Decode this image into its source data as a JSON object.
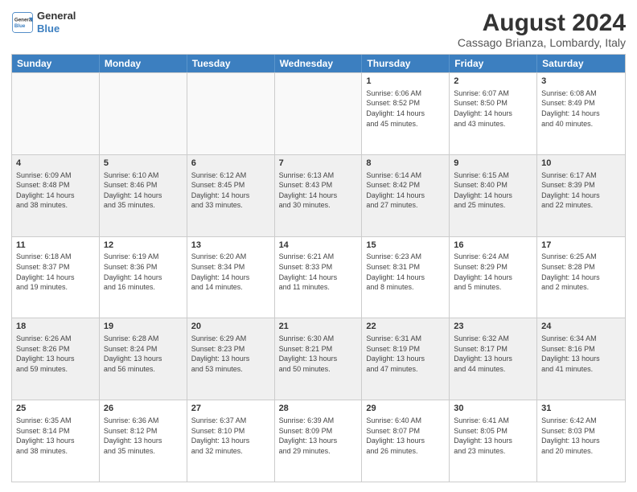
{
  "header": {
    "logo_line1": "General",
    "logo_line2": "Blue",
    "main_title": "August 2024",
    "subtitle": "Cassago Brianza, Lombardy, Italy"
  },
  "weekdays": [
    "Sunday",
    "Monday",
    "Tuesday",
    "Wednesday",
    "Thursday",
    "Friday",
    "Saturday"
  ],
  "rows": [
    [
      {
        "day": "",
        "info": "",
        "empty": true
      },
      {
        "day": "",
        "info": "",
        "empty": true
      },
      {
        "day": "",
        "info": "",
        "empty": true
      },
      {
        "day": "",
        "info": "",
        "empty": true
      },
      {
        "day": "1",
        "info": "Sunrise: 6:06 AM\nSunset: 8:52 PM\nDaylight: 14 hours\nand 45 minutes.",
        "empty": false
      },
      {
        "day": "2",
        "info": "Sunrise: 6:07 AM\nSunset: 8:50 PM\nDaylight: 14 hours\nand 43 minutes.",
        "empty": false
      },
      {
        "day": "3",
        "info": "Sunrise: 6:08 AM\nSunset: 8:49 PM\nDaylight: 14 hours\nand 40 minutes.",
        "empty": false
      }
    ],
    [
      {
        "day": "4",
        "info": "Sunrise: 6:09 AM\nSunset: 8:48 PM\nDaylight: 14 hours\nand 38 minutes.",
        "empty": false
      },
      {
        "day": "5",
        "info": "Sunrise: 6:10 AM\nSunset: 8:46 PM\nDaylight: 14 hours\nand 35 minutes.",
        "empty": false
      },
      {
        "day": "6",
        "info": "Sunrise: 6:12 AM\nSunset: 8:45 PM\nDaylight: 14 hours\nand 33 minutes.",
        "empty": false
      },
      {
        "day": "7",
        "info": "Sunrise: 6:13 AM\nSunset: 8:43 PM\nDaylight: 14 hours\nand 30 minutes.",
        "empty": false
      },
      {
        "day": "8",
        "info": "Sunrise: 6:14 AM\nSunset: 8:42 PM\nDaylight: 14 hours\nand 27 minutes.",
        "empty": false
      },
      {
        "day": "9",
        "info": "Sunrise: 6:15 AM\nSunset: 8:40 PM\nDaylight: 14 hours\nand 25 minutes.",
        "empty": false
      },
      {
        "day": "10",
        "info": "Sunrise: 6:17 AM\nSunset: 8:39 PM\nDaylight: 14 hours\nand 22 minutes.",
        "empty": false
      }
    ],
    [
      {
        "day": "11",
        "info": "Sunrise: 6:18 AM\nSunset: 8:37 PM\nDaylight: 14 hours\nand 19 minutes.",
        "empty": false
      },
      {
        "day": "12",
        "info": "Sunrise: 6:19 AM\nSunset: 8:36 PM\nDaylight: 14 hours\nand 16 minutes.",
        "empty": false
      },
      {
        "day": "13",
        "info": "Sunrise: 6:20 AM\nSunset: 8:34 PM\nDaylight: 14 hours\nand 14 minutes.",
        "empty": false
      },
      {
        "day": "14",
        "info": "Sunrise: 6:21 AM\nSunset: 8:33 PM\nDaylight: 14 hours\nand 11 minutes.",
        "empty": false
      },
      {
        "day": "15",
        "info": "Sunrise: 6:23 AM\nSunset: 8:31 PM\nDaylight: 14 hours\nand 8 minutes.",
        "empty": false
      },
      {
        "day": "16",
        "info": "Sunrise: 6:24 AM\nSunset: 8:29 PM\nDaylight: 14 hours\nand 5 minutes.",
        "empty": false
      },
      {
        "day": "17",
        "info": "Sunrise: 6:25 AM\nSunset: 8:28 PM\nDaylight: 14 hours\nand 2 minutes.",
        "empty": false
      }
    ],
    [
      {
        "day": "18",
        "info": "Sunrise: 6:26 AM\nSunset: 8:26 PM\nDaylight: 13 hours\nand 59 minutes.",
        "empty": false
      },
      {
        "day": "19",
        "info": "Sunrise: 6:28 AM\nSunset: 8:24 PM\nDaylight: 13 hours\nand 56 minutes.",
        "empty": false
      },
      {
        "day": "20",
        "info": "Sunrise: 6:29 AM\nSunset: 8:23 PM\nDaylight: 13 hours\nand 53 minutes.",
        "empty": false
      },
      {
        "day": "21",
        "info": "Sunrise: 6:30 AM\nSunset: 8:21 PM\nDaylight: 13 hours\nand 50 minutes.",
        "empty": false
      },
      {
        "day": "22",
        "info": "Sunrise: 6:31 AM\nSunset: 8:19 PM\nDaylight: 13 hours\nand 47 minutes.",
        "empty": false
      },
      {
        "day": "23",
        "info": "Sunrise: 6:32 AM\nSunset: 8:17 PM\nDaylight: 13 hours\nand 44 minutes.",
        "empty": false
      },
      {
        "day": "24",
        "info": "Sunrise: 6:34 AM\nSunset: 8:16 PM\nDaylight: 13 hours\nand 41 minutes.",
        "empty": false
      }
    ],
    [
      {
        "day": "25",
        "info": "Sunrise: 6:35 AM\nSunset: 8:14 PM\nDaylight: 13 hours\nand 38 minutes.",
        "empty": false
      },
      {
        "day": "26",
        "info": "Sunrise: 6:36 AM\nSunset: 8:12 PM\nDaylight: 13 hours\nand 35 minutes.",
        "empty": false
      },
      {
        "day": "27",
        "info": "Sunrise: 6:37 AM\nSunset: 8:10 PM\nDaylight: 13 hours\nand 32 minutes.",
        "empty": false
      },
      {
        "day": "28",
        "info": "Sunrise: 6:39 AM\nSunset: 8:09 PM\nDaylight: 13 hours\nand 29 minutes.",
        "empty": false
      },
      {
        "day": "29",
        "info": "Sunrise: 6:40 AM\nSunset: 8:07 PM\nDaylight: 13 hours\nand 26 minutes.",
        "empty": false
      },
      {
        "day": "30",
        "info": "Sunrise: 6:41 AM\nSunset: 8:05 PM\nDaylight: 13 hours\nand 23 minutes.",
        "empty": false
      },
      {
        "day": "31",
        "info": "Sunrise: 6:42 AM\nSunset: 8:03 PM\nDaylight: 13 hours\nand 20 minutes.",
        "empty": false
      }
    ]
  ]
}
